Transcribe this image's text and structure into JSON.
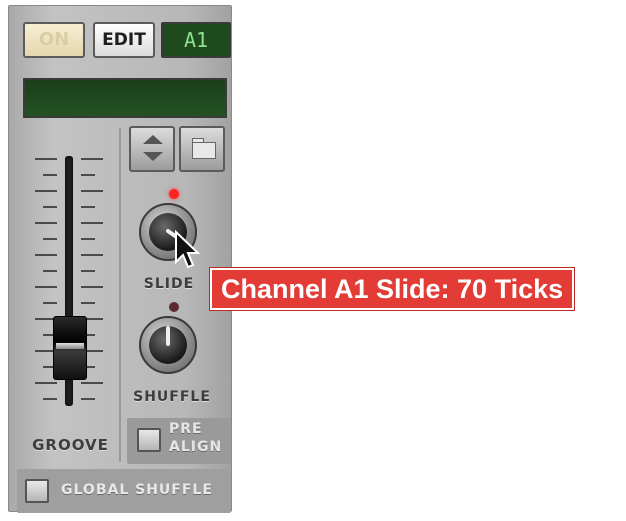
{
  "device": {
    "on_button": "ON",
    "edit_button": "EDIT",
    "channel_display": "A1",
    "name_display": ""
  },
  "groove": {
    "label": "GROOVE",
    "fader_level": 0.25
  },
  "knobs": {
    "slide_label": "SLIDE",
    "shuffle_label": "SHUFFLE"
  },
  "buttons": {
    "pre_align_line1": "PRE",
    "pre_align_line2": "ALIGN",
    "global_shuffle": "GLOBAL SHUFFLE"
  },
  "tooltip": {
    "text": "Channel A1 Slide: 70 Ticks"
  },
  "colors": {
    "led_active": "#ff2222",
    "led_inactive": "#5a2a30",
    "tooltip_bg": "#e33b35",
    "display_green": "#1e4a1e"
  },
  "icons": {
    "pattern_up": "arrow-up-icon",
    "pattern_down": "arrow-down-icon",
    "browse": "folder-icon",
    "cursor": "mouse-cursor-icon"
  }
}
